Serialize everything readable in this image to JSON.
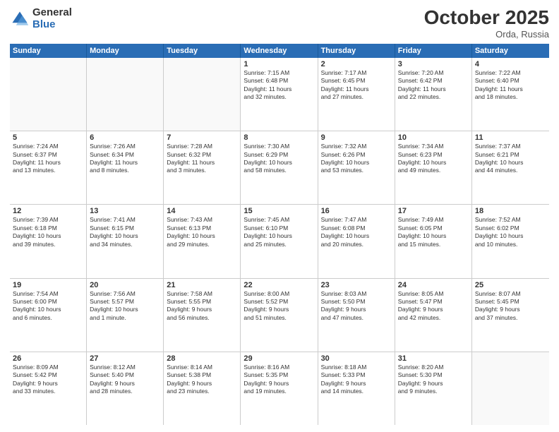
{
  "logo": {
    "general": "General",
    "blue": "Blue"
  },
  "header": {
    "month": "October 2025",
    "location": "Orda, Russia"
  },
  "weekdays": [
    "Sunday",
    "Monday",
    "Tuesday",
    "Wednesday",
    "Thursday",
    "Friday",
    "Saturday"
  ],
  "rows": [
    [
      {
        "day": "",
        "text": "",
        "empty": true
      },
      {
        "day": "",
        "text": "",
        "empty": true
      },
      {
        "day": "",
        "text": "",
        "empty": true
      },
      {
        "day": "1",
        "text": "Sunrise: 7:15 AM\nSunset: 6:48 PM\nDaylight: 11 hours\nand 32 minutes."
      },
      {
        "day": "2",
        "text": "Sunrise: 7:17 AM\nSunset: 6:45 PM\nDaylight: 11 hours\nand 27 minutes."
      },
      {
        "day": "3",
        "text": "Sunrise: 7:20 AM\nSunset: 6:42 PM\nDaylight: 11 hours\nand 22 minutes."
      },
      {
        "day": "4",
        "text": "Sunrise: 7:22 AM\nSunset: 6:40 PM\nDaylight: 11 hours\nand 18 minutes."
      }
    ],
    [
      {
        "day": "5",
        "text": "Sunrise: 7:24 AM\nSunset: 6:37 PM\nDaylight: 11 hours\nand 13 minutes."
      },
      {
        "day": "6",
        "text": "Sunrise: 7:26 AM\nSunset: 6:34 PM\nDaylight: 11 hours\nand 8 minutes."
      },
      {
        "day": "7",
        "text": "Sunrise: 7:28 AM\nSunset: 6:32 PM\nDaylight: 11 hours\nand 3 minutes."
      },
      {
        "day": "8",
        "text": "Sunrise: 7:30 AM\nSunset: 6:29 PM\nDaylight: 10 hours\nand 58 minutes."
      },
      {
        "day": "9",
        "text": "Sunrise: 7:32 AM\nSunset: 6:26 PM\nDaylight: 10 hours\nand 53 minutes."
      },
      {
        "day": "10",
        "text": "Sunrise: 7:34 AM\nSunset: 6:23 PM\nDaylight: 10 hours\nand 49 minutes."
      },
      {
        "day": "11",
        "text": "Sunrise: 7:37 AM\nSunset: 6:21 PM\nDaylight: 10 hours\nand 44 minutes."
      }
    ],
    [
      {
        "day": "12",
        "text": "Sunrise: 7:39 AM\nSunset: 6:18 PM\nDaylight: 10 hours\nand 39 minutes."
      },
      {
        "day": "13",
        "text": "Sunrise: 7:41 AM\nSunset: 6:15 PM\nDaylight: 10 hours\nand 34 minutes."
      },
      {
        "day": "14",
        "text": "Sunrise: 7:43 AM\nSunset: 6:13 PM\nDaylight: 10 hours\nand 29 minutes."
      },
      {
        "day": "15",
        "text": "Sunrise: 7:45 AM\nSunset: 6:10 PM\nDaylight: 10 hours\nand 25 minutes."
      },
      {
        "day": "16",
        "text": "Sunrise: 7:47 AM\nSunset: 6:08 PM\nDaylight: 10 hours\nand 20 minutes."
      },
      {
        "day": "17",
        "text": "Sunrise: 7:49 AM\nSunset: 6:05 PM\nDaylight: 10 hours\nand 15 minutes."
      },
      {
        "day": "18",
        "text": "Sunrise: 7:52 AM\nSunset: 6:02 PM\nDaylight: 10 hours\nand 10 minutes."
      }
    ],
    [
      {
        "day": "19",
        "text": "Sunrise: 7:54 AM\nSunset: 6:00 PM\nDaylight: 10 hours\nand 6 minutes."
      },
      {
        "day": "20",
        "text": "Sunrise: 7:56 AM\nSunset: 5:57 PM\nDaylight: 10 hours\nand 1 minute."
      },
      {
        "day": "21",
        "text": "Sunrise: 7:58 AM\nSunset: 5:55 PM\nDaylight: 9 hours\nand 56 minutes."
      },
      {
        "day": "22",
        "text": "Sunrise: 8:00 AM\nSunset: 5:52 PM\nDaylight: 9 hours\nand 51 minutes."
      },
      {
        "day": "23",
        "text": "Sunrise: 8:03 AM\nSunset: 5:50 PM\nDaylight: 9 hours\nand 47 minutes."
      },
      {
        "day": "24",
        "text": "Sunrise: 8:05 AM\nSunset: 5:47 PM\nDaylight: 9 hours\nand 42 minutes."
      },
      {
        "day": "25",
        "text": "Sunrise: 8:07 AM\nSunset: 5:45 PM\nDaylight: 9 hours\nand 37 minutes."
      }
    ],
    [
      {
        "day": "26",
        "text": "Sunrise: 8:09 AM\nSunset: 5:42 PM\nDaylight: 9 hours\nand 33 minutes."
      },
      {
        "day": "27",
        "text": "Sunrise: 8:12 AM\nSunset: 5:40 PM\nDaylight: 9 hours\nand 28 minutes."
      },
      {
        "day": "28",
        "text": "Sunrise: 8:14 AM\nSunset: 5:38 PM\nDaylight: 9 hours\nand 23 minutes."
      },
      {
        "day": "29",
        "text": "Sunrise: 8:16 AM\nSunset: 5:35 PM\nDaylight: 9 hours\nand 19 minutes."
      },
      {
        "day": "30",
        "text": "Sunrise: 8:18 AM\nSunset: 5:33 PM\nDaylight: 9 hours\nand 14 minutes."
      },
      {
        "day": "31",
        "text": "Sunrise: 8:20 AM\nSunset: 5:30 PM\nDaylight: 9 hours\nand 9 minutes."
      },
      {
        "day": "",
        "text": "",
        "empty": true
      }
    ]
  ]
}
